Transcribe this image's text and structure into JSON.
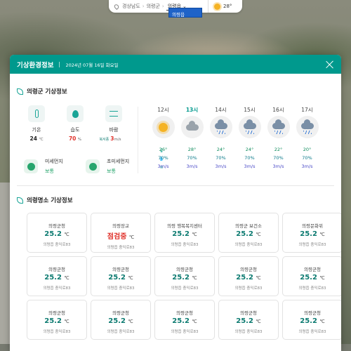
{
  "topbar": {
    "crumbs": [
      "경상남도",
      "의령군"
    ],
    "selected": "의령읍",
    "dropdown_option": "의령읍",
    "temp": "28°"
  },
  "panel": {
    "title": "기상환경정보",
    "date": "2024년 07월 16일 화요일",
    "section1_title": "의령군 기상정보",
    "section2_title": "의령명소 기상정보"
  },
  "current": {
    "temp_label": "기온",
    "temp_value": "24",
    "temp_unit": "℃",
    "hum_label": "습도",
    "hum_value": "70",
    "hum_unit": "%",
    "wind_label": "바람",
    "wind_dir": "북서풍",
    "wind_value": "3",
    "wind_unit": "m/s"
  },
  "dust": [
    {
      "label": "미세먼지",
      "level": "보통"
    },
    {
      "label": "초미세먼지",
      "level": "보통"
    }
  ],
  "hourly": [
    {
      "hour": "12시",
      "icon": "sun-icon",
      "temp": "26°",
      "hum": "70%",
      "wind": "3m/s",
      "now": false
    },
    {
      "hour": "13시",
      "icon": "cloud-icon",
      "temp": "28°",
      "hum": "70%",
      "wind": "3m/s",
      "now": true
    },
    {
      "hour": "14시",
      "icon": "rain-icon",
      "temp": "24°",
      "hum": "70%",
      "wind": "3m/s",
      "now": false
    },
    {
      "hour": "15시",
      "icon": "rain-icon",
      "temp": "24°",
      "hum": "70%",
      "wind": "3m/s",
      "now": false
    },
    {
      "hour": "16시",
      "icon": "rain-icon",
      "temp": "22°",
      "hum": "70%",
      "wind": "3m/s",
      "now": false
    },
    {
      "hour": "17시",
      "icon": "rain-icon",
      "temp": "20°",
      "hum": "70%",
      "wind": "3m/s",
      "now": false
    }
  ],
  "locations": [
    {
      "name": "의령군청",
      "temp": "25.2",
      "unit": "℃",
      "addr": "의령읍 충익로83",
      "insp": false
    },
    {
      "name": "의령장교",
      "temp": "점검중",
      "unit": "℃",
      "addr": "의령읍 충익로83",
      "insp": true
    },
    {
      "name": "의령 행복복지센터",
      "temp": "25.2",
      "unit": "℃",
      "addr": "의령읍 충익로83",
      "insp": false
    },
    {
      "name": "의령군 보건소",
      "temp": "25.2",
      "unit": "℃",
      "addr": "의령읍 충익로83",
      "insp": false
    },
    {
      "name": "의령문화위",
      "temp": "25.2",
      "unit": "℃",
      "addr": "의령읍 충익로83",
      "insp": false
    },
    {
      "name": "의령군청",
      "temp": "25.2",
      "unit": "℃",
      "addr": "의령읍 충익로83",
      "insp": false
    },
    {
      "name": "의령군청",
      "temp": "25.2",
      "unit": "℃",
      "addr": "의령읍 충익로83",
      "insp": false
    },
    {
      "name": "의령군청",
      "temp": "25.2",
      "unit": "℃",
      "addr": "의령읍 충익로83",
      "insp": false
    },
    {
      "name": "의령군청",
      "temp": "25.2",
      "unit": "℃",
      "addr": "의령읍 충익로83",
      "insp": false
    },
    {
      "name": "의령군청",
      "temp": "25.2",
      "unit": "℃",
      "addr": "의령읍 충익로83",
      "insp": false
    },
    {
      "name": "의령군청",
      "temp": "25.2",
      "unit": "℃",
      "addr": "의령읍 충익로83",
      "insp": false
    },
    {
      "name": "의령군청",
      "temp": "25.2",
      "unit": "℃",
      "addr": "의령읍 충익로83",
      "insp": false
    },
    {
      "name": "의령군청",
      "temp": "25.2",
      "unit": "℃",
      "addr": "의령읍 충익로83",
      "insp": false
    },
    {
      "name": "의령군청",
      "temp": "25.2",
      "unit": "℃",
      "addr": "의령읍 충익로83",
      "insp": false
    },
    {
      "name": "의령군청",
      "temp": "25.2",
      "unit": "℃",
      "addr": "의령읍 충익로83",
      "insp": false
    }
  ],
  "colors": {
    "accent": "#00998d",
    "alert": "#e0312a",
    "select": "#1f63c8"
  }
}
